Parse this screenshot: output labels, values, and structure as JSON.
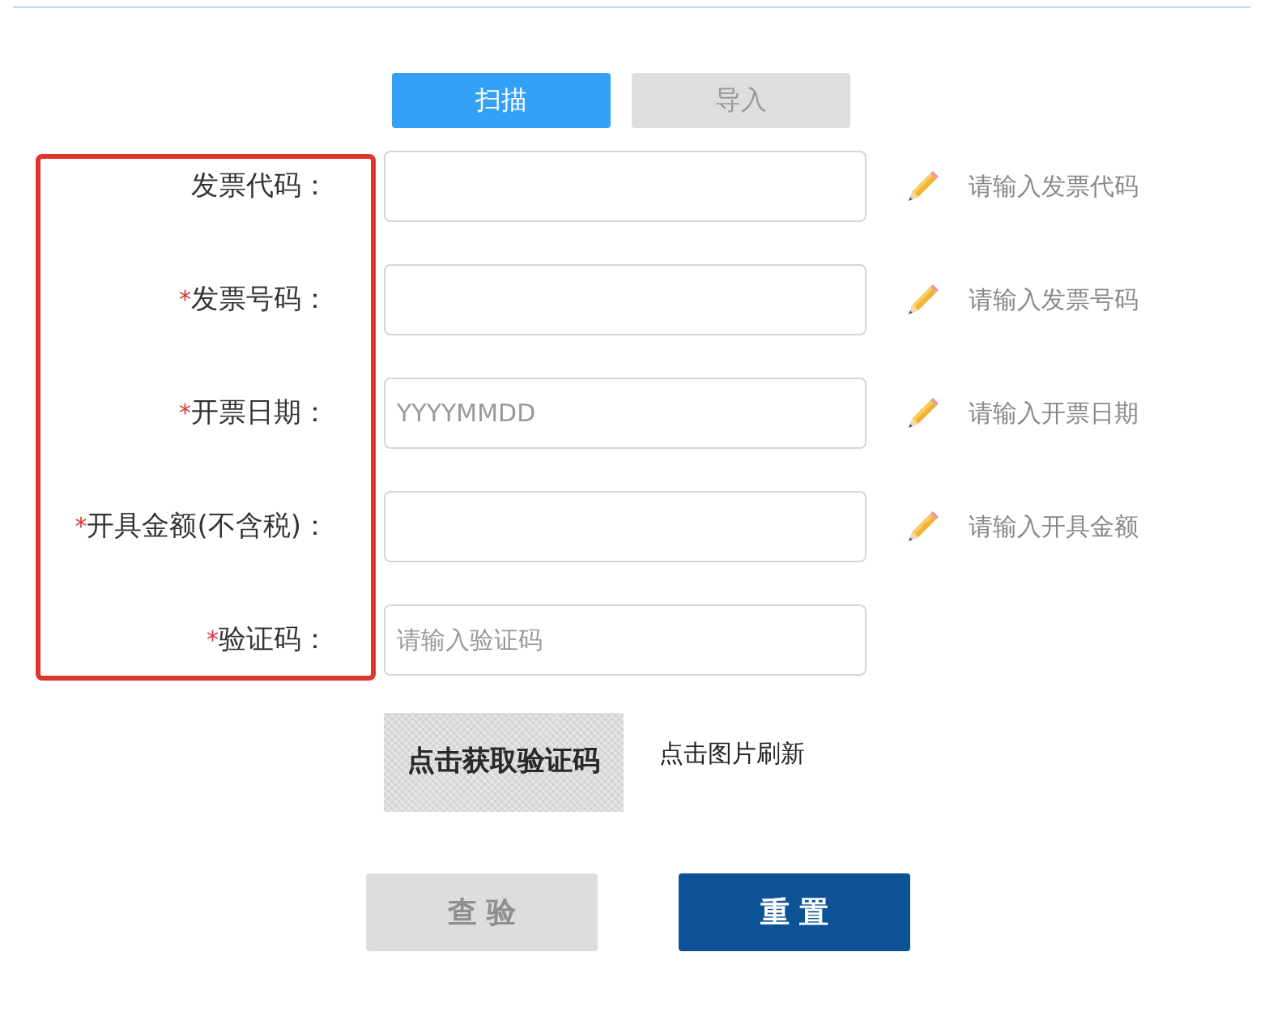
{
  "mode_tabs": [
    {
      "label": "扫描",
      "selected": true
    },
    {
      "label": "导入",
      "selected": false
    }
  ],
  "labels_highlighted": true,
  "fields": [
    {
      "label": "发票代码：",
      "hint": "请输入发票代码"
    },
    {
      "required_mark": "*",
      "label": "发票号码：",
      "hint": "请输入发票号码"
    },
    {
      "required_mark": "*",
      "label": "开票日期：",
      "placeholder": "YYYYMMDD",
      "hint": "请输入开票日期"
    },
    {
      "required_mark": "*",
      "label": "开具金额(不含税)：",
      "hint": "请输入开具金额"
    },
    {
      "required_mark": "*",
      "label": "验证码：",
      "placeholder": "请输入验证码"
    }
  ],
  "captcha": {
    "image_text": "点击获取验证码",
    "refresh_hint": "点击图片刷新"
  },
  "actions": [
    {
      "label": "查验",
      "disabled": true
    },
    {
      "label": "重置",
      "disabled": false
    }
  ]
}
